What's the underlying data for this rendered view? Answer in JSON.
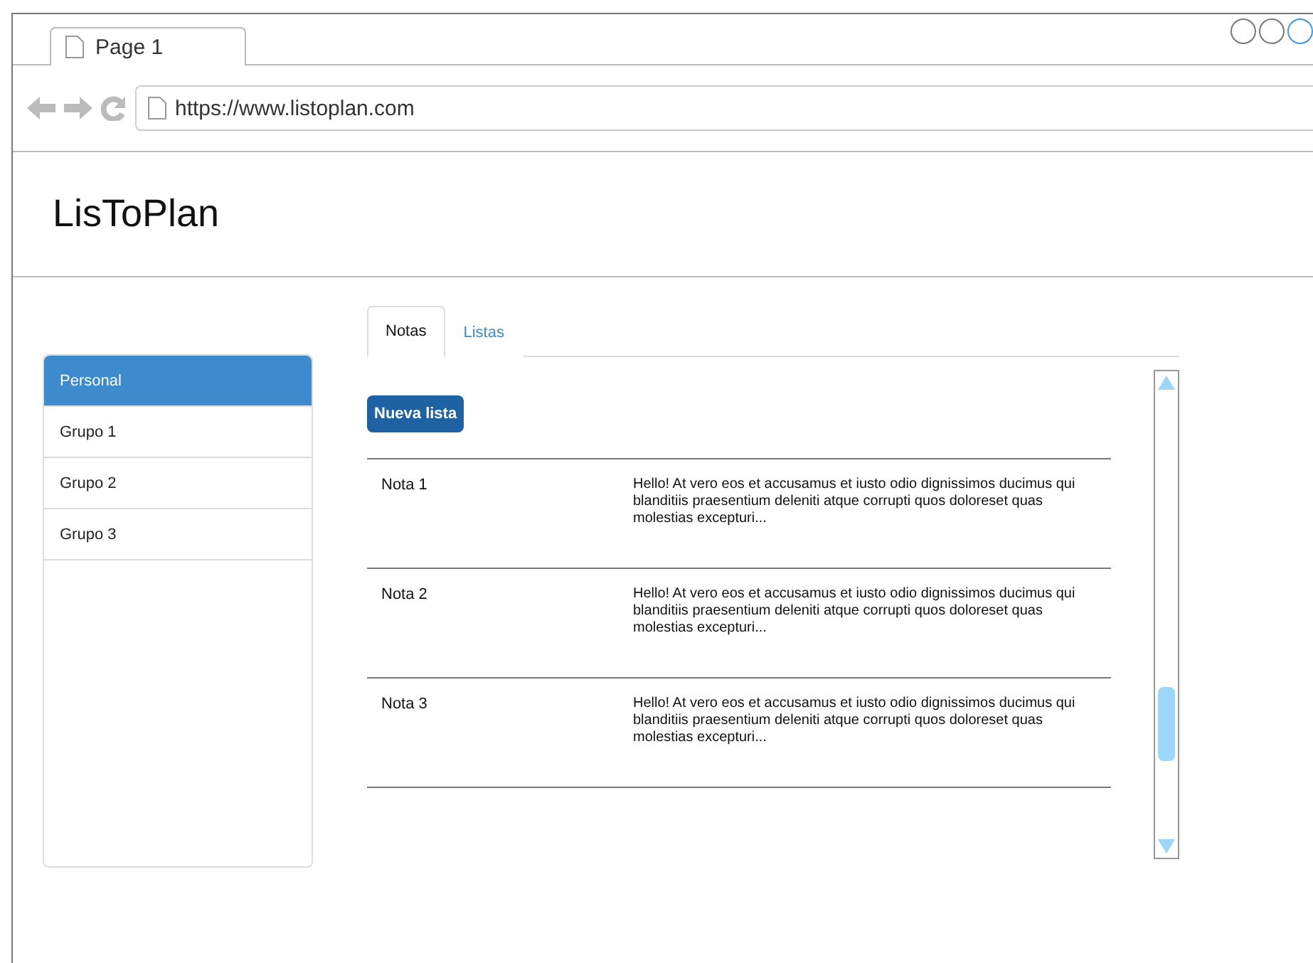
{
  "browser": {
    "tab": {
      "label": "Page 1"
    },
    "url": "https://www.listoplan.com"
  },
  "header": {
    "title": "LisToPlan"
  },
  "sidebar": {
    "items": [
      {
        "label": "Personal",
        "selected": true
      },
      {
        "label": "Grupo 1",
        "selected": false
      },
      {
        "label": "Grupo 2",
        "selected": false
      },
      {
        "label": "Grupo 3",
        "selected": false
      }
    ]
  },
  "tabs": [
    {
      "label": "Notas",
      "selected": true
    },
    {
      "label": "Listas",
      "selected": false
    }
  ],
  "new_button": "Nueva lista",
  "notes": [
    {
      "title": "Nota 1",
      "text": "Hello! At vero eos et accusamus et iusto odio dignissimos ducimus qui blanditiis praesentium deleniti atque corrupti quos doloreset quas molestias excepturi..."
    },
    {
      "title": "Nota 2",
      "text": "Hello! At vero eos et accusamus et iusto odio dignissimos ducimus qui blanditiis praesentium deleniti atque corrupti quos doloreset quas molestias excepturi..."
    },
    {
      "title": "Nota 3",
      "text": "Hello! At vero eos et accusamus et iusto odio dignissimos ducimus qui blanditiis praesentium deleniti atque corrupti quos doloreset quas molestias excepturi..."
    }
  ]
}
